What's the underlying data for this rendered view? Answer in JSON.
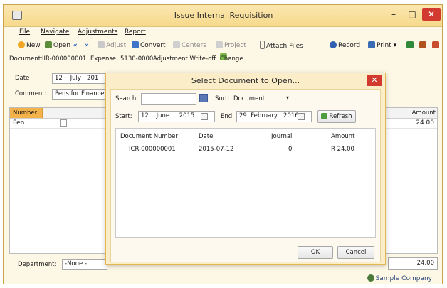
{
  "window": {
    "title": "Issue Internal Requisition",
    "min_glyph": "–",
    "max_glyph": "□",
    "close_glyph": "✕"
  },
  "menu": [
    "File",
    "Navigate",
    "Adjustments",
    "Report"
  ],
  "toolbar": {
    "new": "New",
    "open": "Open",
    "adjust": "Adjust",
    "convert": "Convert",
    "centers": "Centers",
    "project": "Project",
    "attach_files": "Attach Files",
    "record": "Record",
    "print": "Print"
  },
  "info": {
    "document_label": "Document:",
    "document_value": "IIR-000000001",
    "expense_label": "Expense:",
    "expense_value": "5130-0000",
    "expense_desc": "Adjustment Write-off",
    "change": "Change"
  },
  "form": {
    "date_label": "Date",
    "date_day": "12",
    "date_month": "July",
    "date_year": "201",
    "comment_label": "Comment:",
    "comment_value": "Pens for Finance"
  },
  "grid": {
    "col_number": "Number",
    "col_amount": "Amount",
    "row1_number": "Pen",
    "row1_lookup": "...",
    "row1_amount": "24.00"
  },
  "footer": {
    "department_label": "Department:",
    "department_value": "-None -",
    "total": "24.00",
    "company": "Sample Company"
  },
  "dialog": {
    "title": "Select Document to Open...",
    "close_glyph": "✕",
    "search_label": "Search:",
    "search_value": "",
    "sort_label": "Sort:",
    "sort_value": "Document",
    "start_label": "Start:",
    "start_day": "12",
    "start_month": "June",
    "start_year": "2015",
    "end_label": "End:",
    "end_day": "29",
    "end_month": "February",
    "end_year": "2016",
    "refresh": "Refresh",
    "columns": [
      "Document Number",
      "Date",
      "Journal",
      "Amount"
    ],
    "rows": [
      {
        "document_number": "ICR-000000001",
        "date": "2015-07-12",
        "journal": "0",
        "amount": "R 24.00"
      }
    ],
    "ok": "OK",
    "cancel": "Cancel"
  },
  "colors": {
    "titlebar": "#f6d98b",
    "accent_orange": "#f4b24a",
    "close_red": "#d23a2f"
  }
}
